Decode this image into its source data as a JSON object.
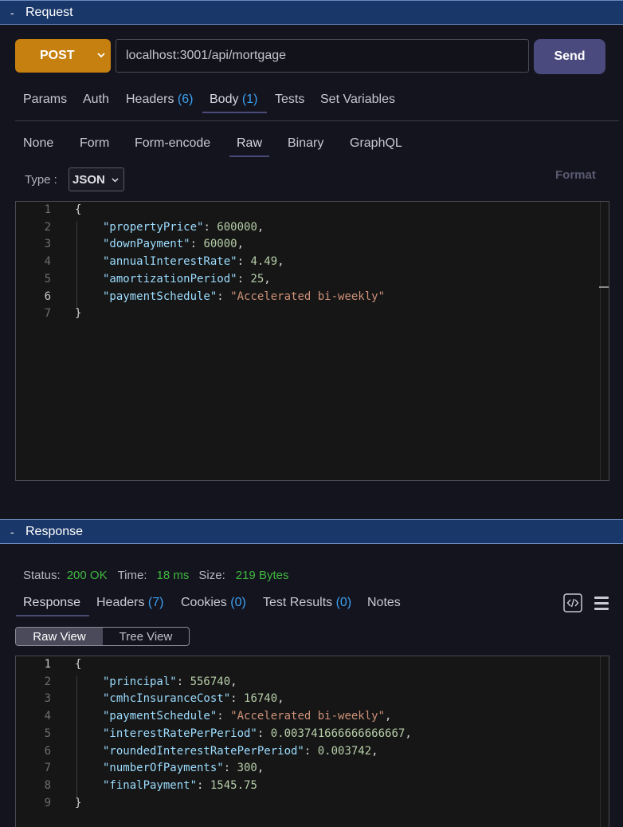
{
  "request": {
    "section_title": "Request",
    "collapse_glyph": "-",
    "method": "POST",
    "url": "localhost:3001/api/mortgage",
    "send_label": "Send",
    "tabs": [
      {
        "label": "Params",
        "count": ""
      },
      {
        "label": "Auth",
        "count": ""
      },
      {
        "label": "Headers",
        "count": "(6)"
      },
      {
        "label": "Body",
        "count": "(1)"
      },
      {
        "label": "Tests",
        "count": ""
      },
      {
        "label": "Set Variables",
        "count": ""
      }
    ],
    "active_tab": "Body",
    "body_types": [
      "None",
      "Form",
      "Form-encode",
      "Raw",
      "Binary",
      "GraphQL"
    ],
    "active_body_type": "Raw",
    "type_label": "Type :",
    "type_value": "JSON",
    "format_label": "Format",
    "current_line": 6
  },
  "response": {
    "section_title": "Response",
    "collapse_glyph": "-",
    "status_label": "Status:",
    "status_value": "200 OK",
    "time_label": "Time:",
    "time_value": "18 ms",
    "size_label": "Size:",
    "size_value": "219 Bytes",
    "tabs": [
      {
        "label": "Response",
        "count": ""
      },
      {
        "label": "Headers",
        "count": "(7)"
      },
      {
        "label": "Cookies",
        "count": "(0)"
      },
      {
        "label": "Test Results",
        "count": "(0)"
      },
      {
        "label": "Notes",
        "count": ""
      }
    ],
    "active_tab": "Response",
    "view_options": [
      "Raw View",
      "Tree View"
    ],
    "active_view": "Raw View",
    "icons": [
      "code-icon",
      "menu-icon"
    ],
    "current_line": 1
  },
  "colors": {
    "header_bg": "#1a3769",
    "method_bg": "#c6800f",
    "send_bg": "#4a4a7e",
    "count": "#3aa0f0",
    "status_ok": "#3fb83f",
    "json_key": "#9cdcfe",
    "json_number": "#b5cea8",
    "json_string": "#ce9178"
  }
}
